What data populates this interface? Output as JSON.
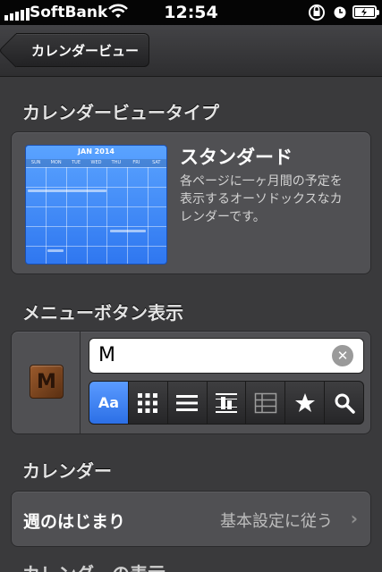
{
  "status_bar": {
    "carrier": "SoftBank",
    "time": "12:54"
  },
  "nav": {
    "back_label": "カレンダービュー"
  },
  "view_type": {
    "header": "カレンダービュータイプ",
    "thumbnail": {
      "month_label": "JAN 2014",
      "weekdays": [
        "SUN",
        "MON",
        "TUE",
        "WED",
        "THU",
        "FRI",
        "SAT"
      ],
      "color": "#3d86f5"
    },
    "title": "スタンダード",
    "description": "各ページに一ヶ月間の予定を表示するオーソドックスなカレンダーです。"
  },
  "menu_button": {
    "header": "メニューボタン表示",
    "icon_letter": "M",
    "title_value": "M",
    "styles": [
      {
        "name": "text-style",
        "label": "Aa",
        "icon": "text-aa-icon",
        "active": true
      },
      {
        "name": "grid-style",
        "icon": "grid-icon",
        "active": false
      },
      {
        "name": "list-style",
        "icon": "list-icon",
        "active": false
      },
      {
        "name": "timeline-style",
        "icon": "timeline-icon",
        "active": false
      },
      {
        "name": "table-style",
        "icon": "table-icon",
        "active": false
      },
      {
        "name": "star-style",
        "icon": "star-icon",
        "active": false
      },
      {
        "name": "search-style",
        "icon": "search-icon",
        "active": false
      }
    ],
    "accent_color": "#3b7ff0"
  },
  "calendar": {
    "header": "カレンダー",
    "week_start_label": "週のはじまり",
    "week_start_value": "基本設定に従う"
  },
  "next_section": {
    "header": "カレンダーの表示"
  }
}
